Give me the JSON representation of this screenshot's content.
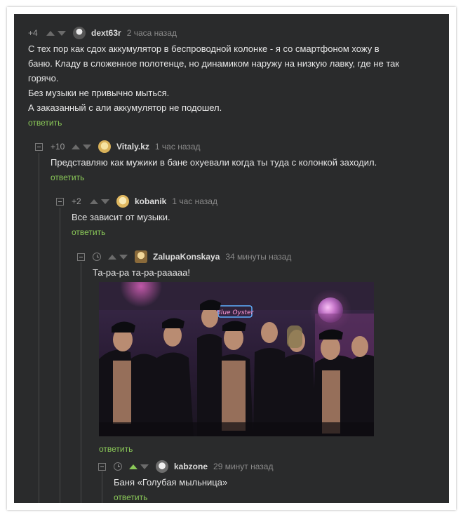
{
  "comments": [
    {
      "rating": "+4",
      "author": "dext63r",
      "time": "2 часа назад",
      "lines": [
        "С тех пор как сдох аккумулятор в беспроводной колонке - я со смартфоном хожу в",
        "баню. Кладу в сложенное полотенце, но динамиком наружу на низкую лавку, где не так",
        "горячо.",
        "Без музыки не привычно мыться.",
        "А заказанный с али аккумулятор не подошел."
      ],
      "reply": "ответить"
    },
    {
      "rating": "+10",
      "author": "Vitaly.kz",
      "time": "1 час назад",
      "lines": [
        "Представляю как мужики в бане охуевали когда ты туда с колонкой заходил."
      ],
      "reply": "ответить"
    },
    {
      "rating": "+2",
      "author": "kobanik",
      "time": "1 час назад",
      "lines": [
        "Все зависит от музыки."
      ],
      "reply": "ответить"
    },
    {
      "rating": "",
      "author": "ZalupaKonskaya",
      "time": "34 минуты назад",
      "lines": [
        "Та-ра-ра та-ра-рааааа!"
      ],
      "reply": "ответить"
    },
    {
      "rating": "",
      "author": "kabzone",
      "time": "29 минут назад",
      "lines": [
        "Баня «Голубая мыльница»"
      ],
      "reply": "ответить"
    }
  ],
  "image": {
    "sign_text": "Blue Oyster"
  },
  "colors": {
    "accent": "#8ac858",
    "panel": "#2a2b2c"
  }
}
